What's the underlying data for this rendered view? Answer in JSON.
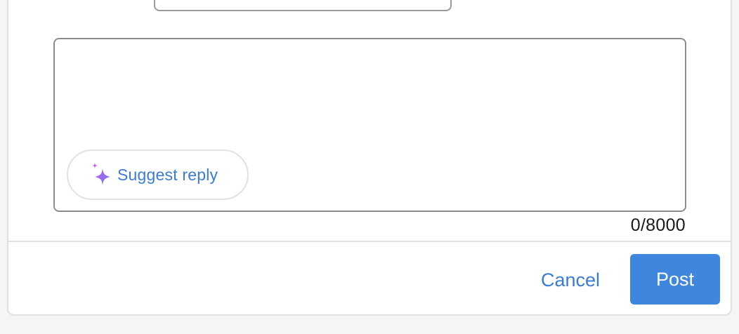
{
  "composer": {
    "textarea_value": "",
    "suggest_label": "Suggest reply",
    "char_count": "0/8000"
  },
  "actions": {
    "cancel_label": "Cancel",
    "post_label": "Post"
  },
  "icons": {
    "suggest": "sparkle-icon"
  },
  "colors": {
    "accent": "#3a7bd5",
    "post_bg": "#3f87de",
    "sparkle_gradient": [
      "#c061e6",
      "#6a7cf0"
    ]
  }
}
